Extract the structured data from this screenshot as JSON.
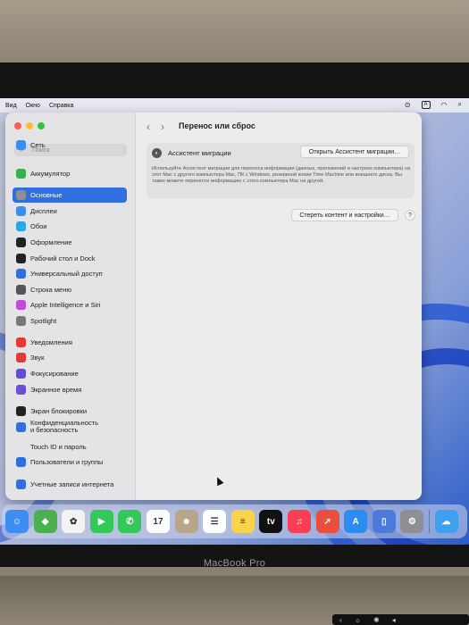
{
  "menubar": {
    "items": [
      "Вид",
      "Окно",
      "Справка"
    ],
    "right_icons": [
      "play-circle-icon",
      "text-input-icon",
      "wifi-icon",
      "search-icon"
    ]
  },
  "window": {
    "title": "Перенос или сброс",
    "search_placeholder": "Поиск",
    "sidebar_items": [
      {
        "label": "Сеть",
        "icon": "network-icon",
        "color": "#3a8df5"
      },
      {
        "label": "Аккумулятор",
        "icon": "battery-icon",
        "color": "#33b34a"
      },
      {
        "label": "Основные",
        "icon": "gear-icon",
        "color": "#8e8e93"
      },
      {
        "label": "Дисплеи",
        "icon": "display-icon",
        "color": "#3a8df5"
      },
      {
        "label": "Обои",
        "icon": "wallpaper-icon",
        "color": "#2aa7e5"
      },
      {
        "label": "Оформление",
        "icon": "appearance-icon",
        "color": "#222222"
      },
      {
        "label": "Рабочий стол и Dock",
        "icon": "dock-icon",
        "color": "#222222"
      },
      {
        "label": "Универсальный доступ",
        "icon": "accessibility-icon",
        "color": "#2f6fe0"
      },
      {
        "label": "Строка меню",
        "icon": "menubar-icon",
        "color": "#555555"
      },
      {
        "label": "Apple Intelligence и Siri",
        "icon": "siri-icon",
        "color": "#c04bd9"
      },
      {
        "label": "Spotlight",
        "icon": "spotlight-icon",
        "color": "#777777"
      },
      {
        "label": "Уведомления",
        "icon": "bell-icon",
        "color": "#e53935"
      },
      {
        "label": "Звук",
        "icon": "sound-icon",
        "color": "#e53935"
      },
      {
        "label": "Фокусирование",
        "icon": "moon-icon",
        "color": "#5e4fd6"
      },
      {
        "label": "Экранное время",
        "icon": "hourglass-icon",
        "color": "#6b4fd6"
      },
      {
        "label": "Экран блокировки",
        "icon": "lock-screen-icon",
        "color": "#222222"
      },
      {
        "label": "Конфиденциальность и безопасность",
        "icon": "hand-icon",
        "color": "#2f6fe0"
      },
      {
        "label": "Touch ID и пароль",
        "icon": "fingerprint-icon",
        "color": "#e5e5e5"
      },
      {
        "label": "Пользователи и группы",
        "icon": "users-icon",
        "color": "#2f6fe0"
      },
      {
        "label": "Учетные записи интернета",
        "icon": "at-icon",
        "color": "#2f6fe0"
      }
    ],
    "selected_index": 2,
    "migration_label": "Ассистент миграции",
    "open_migration_button": "Открыть Ассистент миграции…",
    "description": "Используйте Ассистент миграции для переноса информации (данных, приложений и настроек компьютера) на этот Mac с другого компьютера Mac, ПК с Windows, резервной копии Time Machine или внешнего диска. Вы также можете перенести информацию с этого компьютера Mac на другой.",
    "erase_button": "Стереть контент и настройки…",
    "help_label": "?"
  },
  "dock": {
    "apps": [
      {
        "name": "finder-icon",
        "color": "#3d8ef0",
        "glyph": "☺"
      },
      {
        "name": "maps-icon",
        "color": "#4cb050",
        "glyph": "◆"
      },
      {
        "name": "photos-icon",
        "color": "#f3f3f3",
        "glyph": "✿"
      },
      {
        "name": "facetime-icon",
        "color": "#34c759",
        "glyph": "▶"
      },
      {
        "name": "phone-icon",
        "color": "#34c759",
        "glyph": "✆"
      },
      {
        "name": "calendar-icon",
        "color": "#ffffff",
        "glyph": "17"
      },
      {
        "name": "contacts-icon",
        "color": "#b9a58a",
        "glyph": "☻"
      },
      {
        "name": "reminders-icon",
        "color": "#ffffff",
        "glyph": "☰"
      },
      {
        "name": "notes-icon",
        "color": "#f7d44a",
        "glyph": "≡"
      },
      {
        "name": "tv-icon",
        "color": "#111111",
        "glyph": "tv"
      },
      {
        "name": "music-icon",
        "color": "#fa3e54",
        "glyph": "♫"
      },
      {
        "name": "rocket-icon",
        "color": "#e94f3c",
        "glyph": "➚"
      },
      {
        "name": "app-store-icon",
        "color": "#2d8cf0",
        "glyph": "A"
      },
      {
        "name": "iphone-mirroring-icon",
        "color": "#4b7bd8",
        "glyph": "▯"
      },
      {
        "name": "system-settings-icon",
        "color": "#8e8e93",
        "glyph": "⚙"
      },
      {
        "name": "weather-icon",
        "color": "#3fa0ef",
        "glyph": "☁"
      }
    ]
  },
  "device": {
    "brand": "MacBook Pro"
  }
}
